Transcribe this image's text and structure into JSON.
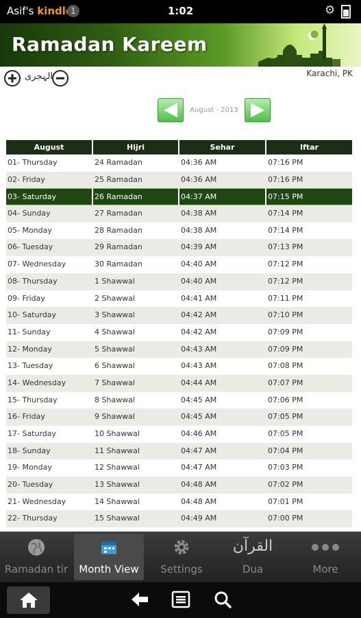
{
  "status_bar": {
    "owner": "Asif's",
    "device": "kindle",
    "notification_count": "1",
    "time": "1:02"
  },
  "header": {
    "title": "Ramadan Kareem"
  },
  "toolbar": {
    "hijri_label": "الہجری",
    "location": "Karachi, PK"
  },
  "month_nav": {
    "label": "August - 2013"
  },
  "table": {
    "headers": [
      "August",
      "Hijri",
      "Sehar",
      "Iftar"
    ],
    "selected_index": 2,
    "rows": [
      [
        "01- Thursday",
        "24 Ramadan",
        "04:36 AM",
        "07:16 PM"
      ],
      [
        "02- Friday",
        "25 Ramadan",
        "04:36 AM",
        "07:16 PM"
      ],
      [
        "03- Saturday",
        "26 Ramadan",
        "04:37 AM",
        "07:15 PM"
      ],
      [
        "04- Sunday",
        "27 Ramadan",
        "04:38 AM",
        "07:14 PM"
      ],
      [
        "05- Monday",
        "28 Ramadan",
        "04:38 AM",
        "07:14 PM"
      ],
      [
        "06- Tuesday",
        "29 Ramadan",
        "04:39 AM",
        "07:13 PM"
      ],
      [
        "07- Wednesday",
        "30 Ramadan",
        "04:40 AM",
        "07:12 PM"
      ],
      [
        "08- Thursday",
        "1 Shawwal",
        "04:40 AM",
        "07:12 PM"
      ],
      [
        "09- Friday",
        "2 Shawwal",
        "04:41 AM",
        "07:11 PM"
      ],
      [
        "10- Saturday",
        "3 Shawwal",
        "04:42 AM",
        "07:10 PM"
      ],
      [
        "11- Sunday",
        "4 Shawwal",
        "04:42 AM",
        "07:09 PM"
      ],
      [
        "12- Monday",
        "5 Shawwal",
        "04:43 AM",
        "07:09 PM"
      ],
      [
        "13- Tuesday",
        "6 Shawwal",
        "04:43 AM",
        "07:08 PM"
      ],
      [
        "14- Wednesday",
        "7 Shawwal",
        "04:44 AM",
        "07:07 PM"
      ],
      [
        "15- Thursday",
        "8 Shawwal",
        "04:45 AM",
        "07:06 PM"
      ],
      [
        "16- Friday",
        "9 Shawwal",
        "04:45 AM",
        "07:05 PM"
      ],
      [
        "17- Saturday",
        "10 Shawwal",
        "04:46 AM",
        "07:05 PM"
      ],
      [
        "18- Sunday",
        "11 Shawwal",
        "04:47 AM",
        "07:04 PM"
      ],
      [
        "19- Monday",
        "12 Shawwal",
        "04:47 AM",
        "07:03 PM"
      ],
      [
        "20- Tuesday",
        "13 Shawwal",
        "04:48 AM",
        "07:02 PM"
      ],
      [
        "21- Wednesday",
        "14 Shawwal",
        "04:48 AM",
        "07:01 PM"
      ],
      [
        "22- Thursday",
        "15 Shawwal",
        "04:49 AM",
        "07:00 PM"
      ]
    ]
  },
  "tabs": [
    {
      "label": "Ramadan tir",
      "icon": "globe-icon",
      "active": false
    },
    {
      "label": "Month View",
      "icon": "calendar-icon",
      "active": true
    },
    {
      "label": "Settings",
      "icon": "gear-icon",
      "active": false
    },
    {
      "label": "Dua",
      "icon": "quran-icon",
      "glyph": "القرآن",
      "active": false
    },
    {
      "label": "More",
      "icon": "more-dots-icon",
      "active": false
    }
  ],
  "colors": {
    "header_green": "#2f5d13",
    "table_header": "#1c2f16",
    "selected_row": "#1f4714",
    "nav_button": "#4dbd46"
  }
}
